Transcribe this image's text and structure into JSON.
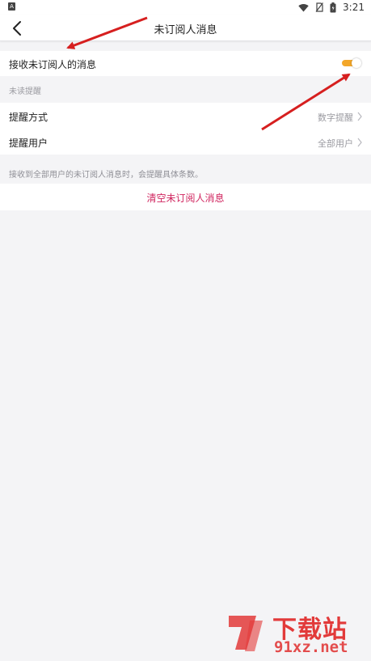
{
  "status_bar": {
    "app_badge": "A",
    "time": "3:21"
  },
  "header": {
    "title": "未订阅人消息",
    "back_icon": "chevron-left-icon"
  },
  "settings": {
    "receive": {
      "label": "接收未订阅人的消息",
      "toggle_on": true,
      "toggle_color": "#f3a72a"
    },
    "section_title": "未读提醒",
    "reminder_mode": {
      "label": "提醒方式",
      "value": "数字提醒"
    },
    "reminder_users": {
      "label": "提醒用户",
      "value": "全部用户"
    },
    "hint": "接收到全部用户的未订阅人消息时，会提醒具体条数。",
    "clear_action": "清空未订阅人消息",
    "clear_color": "#d0255f"
  },
  "watermark": {
    "top_text": "下载站",
    "bottom_text": "91xz.net",
    "color": "#e23a3a"
  }
}
